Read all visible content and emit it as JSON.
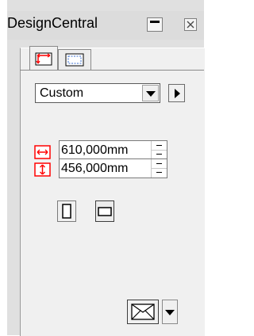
{
  "window": {
    "title": "DesignCentral"
  },
  "titlebar_buttons": {
    "minimize_icon": "minimize-icon",
    "close_icon": "close-icon"
  },
  "tabs": [
    {
      "icon": "page-size-tab-icon",
      "active": true
    },
    {
      "icon": "page-margins-tab-icon",
      "active": false
    }
  ],
  "page_size": {
    "selected": "Custom"
  },
  "width": {
    "value": "610,000mm",
    "icon": "width-arrows-icon"
  },
  "height": {
    "value": "456,000mm",
    "icon": "height-arrows-icon"
  },
  "orientation": {
    "portrait_icon": "portrait-icon",
    "landscape_icon": "landscape-icon",
    "selected": "landscape"
  },
  "envelope": {
    "icon": "envelope-icon"
  },
  "colors": {
    "accent_red": "#ff0000",
    "panel_bg": "#f0f0f0"
  }
}
